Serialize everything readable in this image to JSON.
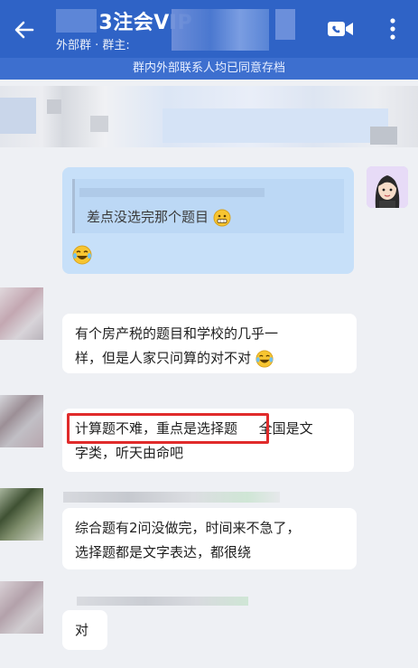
{
  "header": {
    "title": "2023注会VIP",
    "subtitle": "外部群 · 群主:",
    "notice": "群内外部联系人均已同意存档"
  },
  "messages": [
    {
      "id": "m1",
      "sender": "self",
      "quoted": "差点没选完那个题目",
      "emoji_quote": "grimace",
      "emoji": "laugh-cry"
    },
    {
      "id": "m2",
      "sender": "other",
      "line1": "有个房产税的题目和学校的几乎一",
      "line2": "样，但是人家只问算的对不对"
    },
    {
      "id": "m3",
      "sender": "other",
      "highlighted": "计算题不难，重点是选择题",
      "rest": "全国是文",
      "line2": "字类，听天由命吧"
    },
    {
      "id": "m4",
      "sender": "other",
      "line1": "综合题有2问没做完，时间来不急了，",
      "line2": "选择题都是文字表达，都很绕"
    },
    {
      "id": "m5",
      "sender": "other",
      "line1": "对"
    }
  ],
  "colors": {
    "header": "#2f63c6",
    "notice": "#3d6fcf",
    "bubble_self": "#c7e0f9",
    "bubble_other": "#ffffff",
    "highlight": "#e02b2b"
  }
}
